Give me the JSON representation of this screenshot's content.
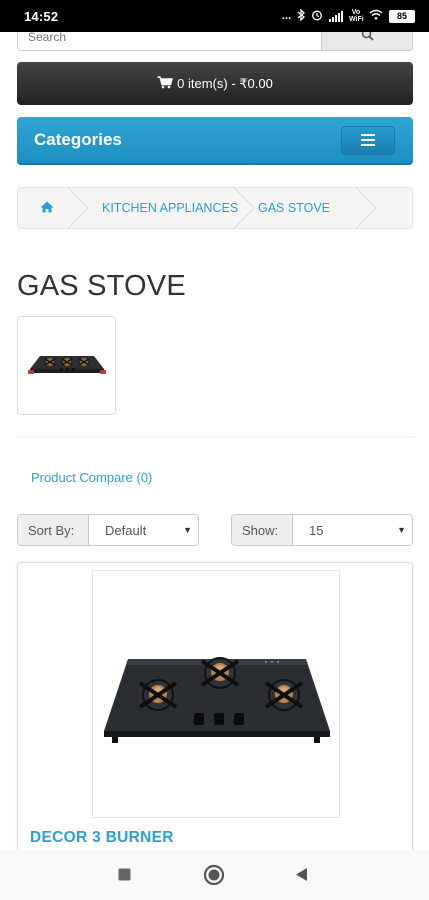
{
  "status_bar": {
    "time": "14:52",
    "dots": "...",
    "network": "Vo WiFi",
    "battery": "85"
  },
  "search": {
    "placeholder": "Search"
  },
  "cart": {
    "label": "0 item(s) - ₹0.00"
  },
  "categories": {
    "title": "Categories"
  },
  "breadcrumb": {
    "items": [
      "KITCHEN APPLIANCES",
      "GAS STOVE"
    ]
  },
  "page": {
    "title": "GAS STOVE"
  },
  "compare": {
    "label": "Product Compare (0)"
  },
  "sort": {
    "label": "Sort By:",
    "value": "Default"
  },
  "show": {
    "label": "Show:",
    "value": "15"
  },
  "products": [
    {
      "name": "DECOR 3 BURNER"
    }
  ],
  "colors": {
    "accent": "#2a9fd6",
    "categories_bar": "#1e8ec0",
    "cart_bar": "#333333"
  }
}
